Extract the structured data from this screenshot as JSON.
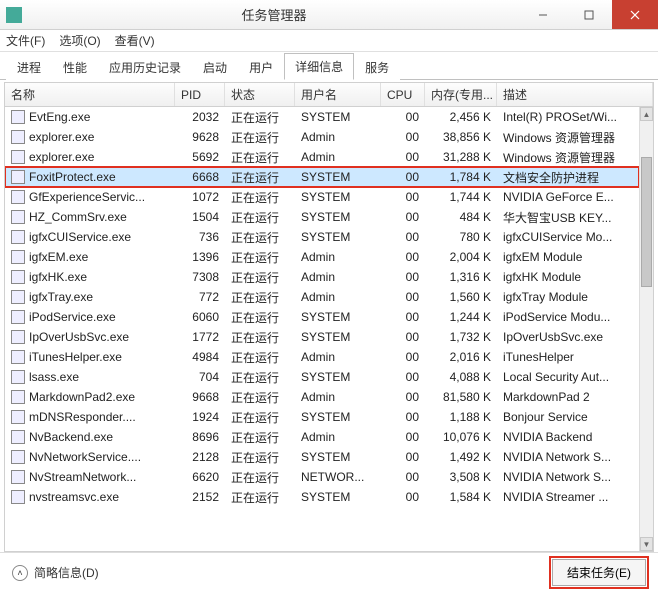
{
  "window": {
    "title": "任务管理器"
  },
  "menu": {
    "file": "文件(F)",
    "options": "选项(O)",
    "view": "查看(V)"
  },
  "tabs": {
    "items": [
      {
        "label": "进程"
      },
      {
        "label": "性能"
      },
      {
        "label": "应用历史记录"
      },
      {
        "label": "启动"
      },
      {
        "label": "用户"
      },
      {
        "label": "详细信息"
      },
      {
        "label": "服务"
      }
    ],
    "active": 5
  },
  "columns": {
    "name": "名称",
    "pid": "PID",
    "status": "状态",
    "user": "用户名",
    "cpu": "CPU",
    "mem": "内存(专用...",
    "desc": "描述"
  },
  "processes": [
    {
      "name": "EvtEng.exe",
      "pid": "2032",
      "status": "正在运行",
      "user": "SYSTEM",
      "cpu": "00",
      "mem": "2,456 K",
      "desc": "Intel(R) PROSet/Wi..."
    },
    {
      "name": "explorer.exe",
      "pid": "9628",
      "status": "正在运行",
      "user": "Admin",
      "cpu": "00",
      "mem": "38,856 K",
      "desc": "Windows 资源管理器"
    },
    {
      "name": "explorer.exe",
      "pid": "5692",
      "status": "正在运行",
      "user": "Admin",
      "cpu": "00",
      "mem": "31,288 K",
      "desc": "Windows 资源管理器"
    },
    {
      "name": "FoxitProtect.exe",
      "pid": "6668",
      "status": "正在运行",
      "user": "SYSTEM",
      "cpu": "00",
      "mem": "1,784 K",
      "desc": "文档安全防护进程",
      "selected": true,
      "highlighted": true
    },
    {
      "name": "GfExperienceServic...",
      "pid": "1072",
      "status": "正在运行",
      "user": "SYSTEM",
      "cpu": "00",
      "mem": "1,744 K",
      "desc": "NVIDIA GeForce E..."
    },
    {
      "name": "HZ_CommSrv.exe",
      "pid": "1504",
      "status": "正在运行",
      "user": "SYSTEM",
      "cpu": "00",
      "mem": "484 K",
      "desc": "华大智宝USB KEY..."
    },
    {
      "name": "igfxCUIService.exe",
      "pid": "736",
      "status": "正在运行",
      "user": "SYSTEM",
      "cpu": "00",
      "mem": "780 K",
      "desc": "igfxCUIService Mo..."
    },
    {
      "name": "igfxEM.exe",
      "pid": "1396",
      "status": "正在运行",
      "user": "Admin",
      "cpu": "00",
      "mem": "2,004 K",
      "desc": "igfxEM Module"
    },
    {
      "name": "igfxHK.exe",
      "pid": "7308",
      "status": "正在运行",
      "user": "Admin",
      "cpu": "00",
      "mem": "1,316 K",
      "desc": "igfxHK Module"
    },
    {
      "name": "igfxTray.exe",
      "pid": "772",
      "status": "正在运行",
      "user": "Admin",
      "cpu": "00",
      "mem": "1,560 K",
      "desc": "igfxTray Module"
    },
    {
      "name": "iPodService.exe",
      "pid": "6060",
      "status": "正在运行",
      "user": "SYSTEM",
      "cpu": "00",
      "mem": "1,244 K",
      "desc": "iPodService Modu..."
    },
    {
      "name": "IpOverUsbSvc.exe",
      "pid": "1772",
      "status": "正在运行",
      "user": "SYSTEM",
      "cpu": "00",
      "mem": "1,732 K",
      "desc": "IpOverUsbSvc.exe"
    },
    {
      "name": "iTunesHelper.exe",
      "pid": "4984",
      "status": "正在运行",
      "user": "Admin",
      "cpu": "00",
      "mem": "2,016 K",
      "desc": "iTunesHelper"
    },
    {
      "name": "lsass.exe",
      "pid": "704",
      "status": "正在运行",
      "user": "SYSTEM",
      "cpu": "00",
      "mem": "4,088 K",
      "desc": "Local Security Aut..."
    },
    {
      "name": "MarkdownPad2.exe",
      "pid": "9668",
      "status": "正在运行",
      "user": "Admin",
      "cpu": "00",
      "mem": "81,580 K",
      "desc": "MarkdownPad 2"
    },
    {
      "name": "mDNSResponder....",
      "pid": "1924",
      "status": "正在运行",
      "user": "SYSTEM",
      "cpu": "00",
      "mem": "1,188 K",
      "desc": "Bonjour Service"
    },
    {
      "name": "NvBackend.exe",
      "pid": "8696",
      "status": "正在运行",
      "user": "Admin",
      "cpu": "00",
      "mem": "10,076 K",
      "desc": "NVIDIA Backend"
    },
    {
      "name": "NvNetworkService....",
      "pid": "2128",
      "status": "正在运行",
      "user": "SYSTEM",
      "cpu": "00",
      "mem": "1,492 K",
      "desc": "NVIDIA Network S..."
    },
    {
      "name": "NvStreamNetwork...",
      "pid": "6620",
      "status": "正在运行",
      "user": "NETWOR...",
      "cpu": "00",
      "mem": "3,508 K",
      "desc": "NVIDIA Network S..."
    },
    {
      "name": "nvstreamsvc.exe",
      "pid": "2152",
      "status": "正在运行",
      "user": "SYSTEM",
      "cpu": "00",
      "mem": "1,584 K",
      "desc": "NVIDIA Streamer ..."
    }
  ],
  "footer": {
    "fewer": "简略信息(D)",
    "end_task": "结束任务(E)"
  }
}
